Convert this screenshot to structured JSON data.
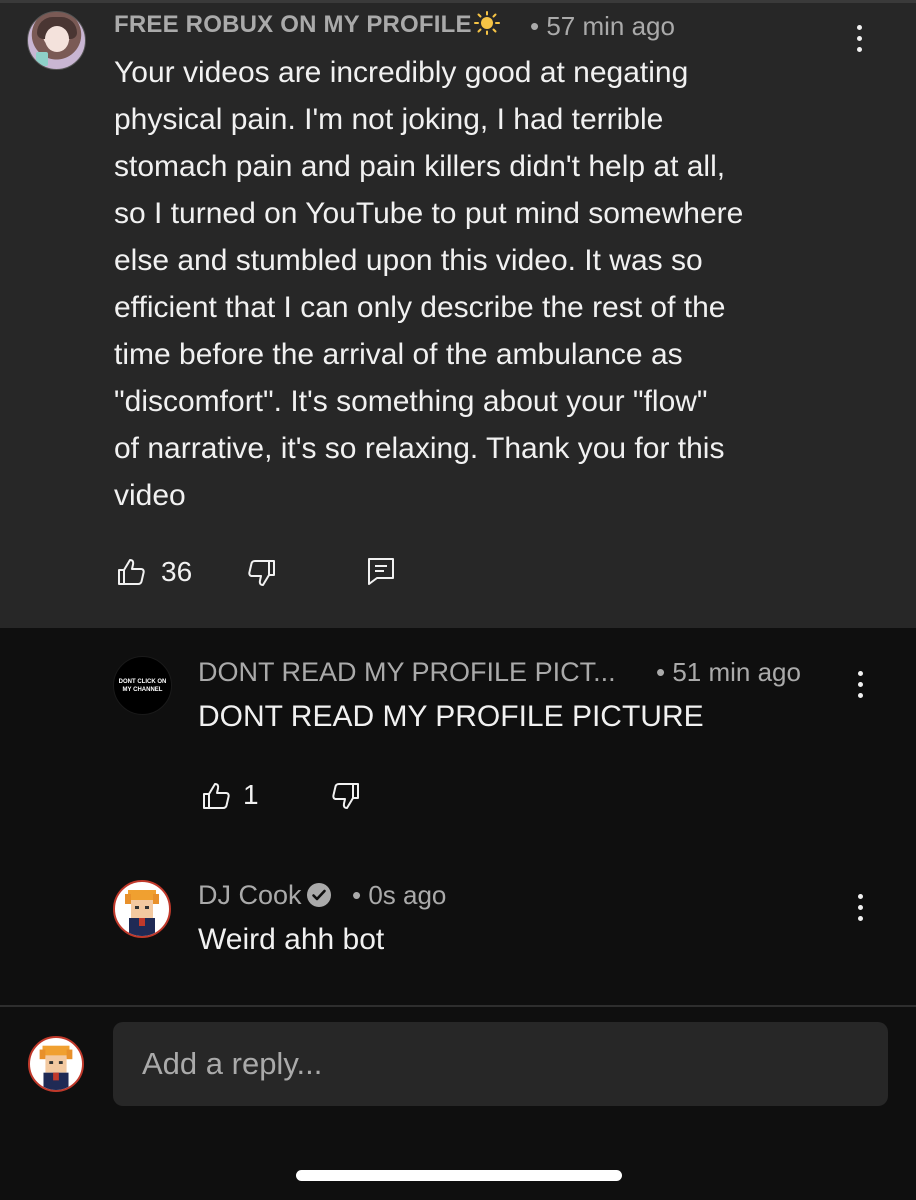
{
  "top_comment": {
    "author": "FREE ROBUX ON MY PROFILE",
    "author_icon": "sun-icon",
    "time": "• 57 min ago",
    "text": "Your videos are incredibly good at negating\nphysical pain. I'm not joking, I had terrible\nstomach pain and pain killers didn't help at all,\nso I turned on YouTube to put mind somewhere\nelse and stumbled upon this video. It was so\nefficient that I can only describe the rest of the\ntime before the arrival of the ambulance as\n\"discomfort\". It's something about your \"flow\"\nof narrative, it's so relaxing. Thank you for this\nvideo",
    "likes": "36"
  },
  "replies": [
    {
      "author": "DONT READ MY PROFILE PICT...",
      "avatar_text": "DONT CLICK ON MY CHANNEL",
      "time": "• 51 min ago",
      "text": "DONT READ MY PROFILE PICTURE",
      "likes": "1"
    },
    {
      "author": "DJ Cook",
      "verified": true,
      "time": "• 0s ago",
      "text": "Weird ahh bot"
    }
  ],
  "reply_box": {
    "placeholder": "Add a reply..."
  },
  "colors": {
    "background": "#0f0f0f",
    "highlighted_comment": "#272727",
    "secondary_text": "#aaaaaa",
    "primary_text": "#f1f1f1"
  }
}
